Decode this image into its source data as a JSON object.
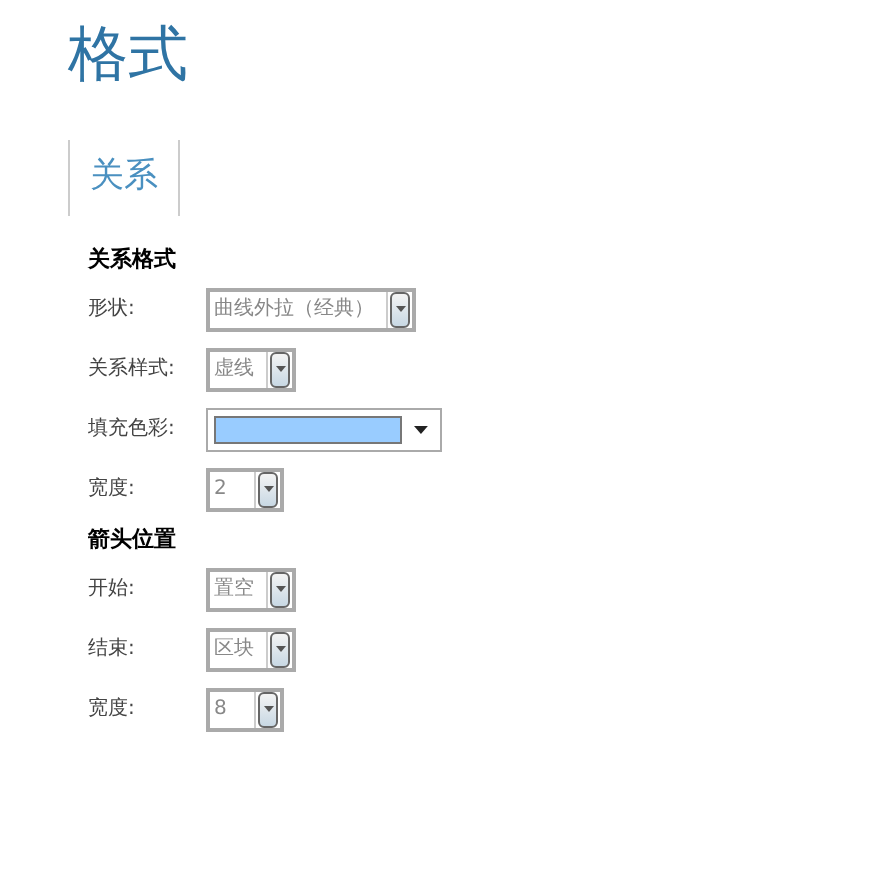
{
  "title": "格式",
  "tabs": [
    {
      "label": "关系",
      "selected": true
    }
  ],
  "sections": [
    {
      "heading": "关系格式",
      "fields": [
        {
          "label": "形状:",
          "kind": "select",
          "value": "曲线外拉（经典）"
        },
        {
          "label": "关系样式:",
          "kind": "select",
          "value": "虚线"
        },
        {
          "label": "填充色彩:",
          "kind": "color",
          "color": "#99ccff"
        },
        {
          "label": "宽度:",
          "kind": "select",
          "value": "2"
        }
      ]
    },
    {
      "heading": "箭头位置",
      "fields": [
        {
          "label": "开始:",
          "kind": "select",
          "value": "置空"
        },
        {
          "label": "结束:",
          "kind": "select",
          "value": "区块"
        },
        {
          "label": "宽度:",
          "kind": "select",
          "value": "8"
        }
      ]
    }
  ]
}
